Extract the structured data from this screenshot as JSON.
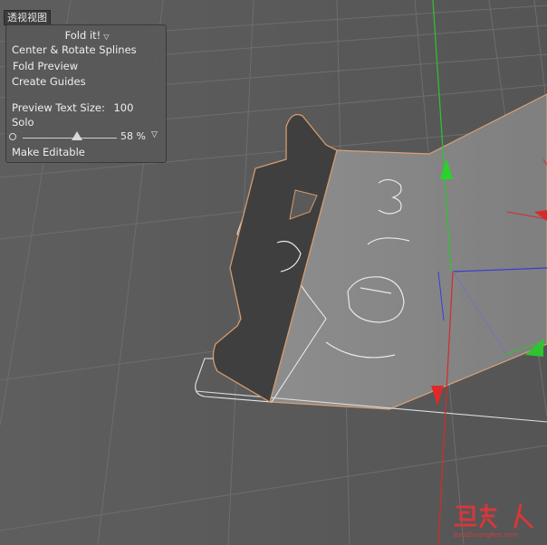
{
  "viewport": {
    "label": "透视视图"
  },
  "panel": {
    "title": "Fold it!",
    "items": [
      "Center & Rotate Splines",
      "Fold Preview",
      "Create Guides"
    ],
    "preview_text_size_label": "Preview Text Size:",
    "preview_text_size_value": "100",
    "solo_label": "Solo",
    "slider_value": "58 %",
    "slider_fraction": 0.58,
    "make_editable_label": "Make Editable"
  },
  "watermark": {
    "url": "BaoZhuangRen.com"
  },
  "colors": {
    "viewport_bg": "#5b5b5b",
    "grid_line": "#6c6c6c",
    "y_axis": "#2fc42f",
    "x_axis": "#d62a2a",
    "z_axis": "#3737d8",
    "outline_orange": "#d9a070",
    "dark_face": "#3e3e3e",
    "light_face": "#8a8a8a"
  }
}
